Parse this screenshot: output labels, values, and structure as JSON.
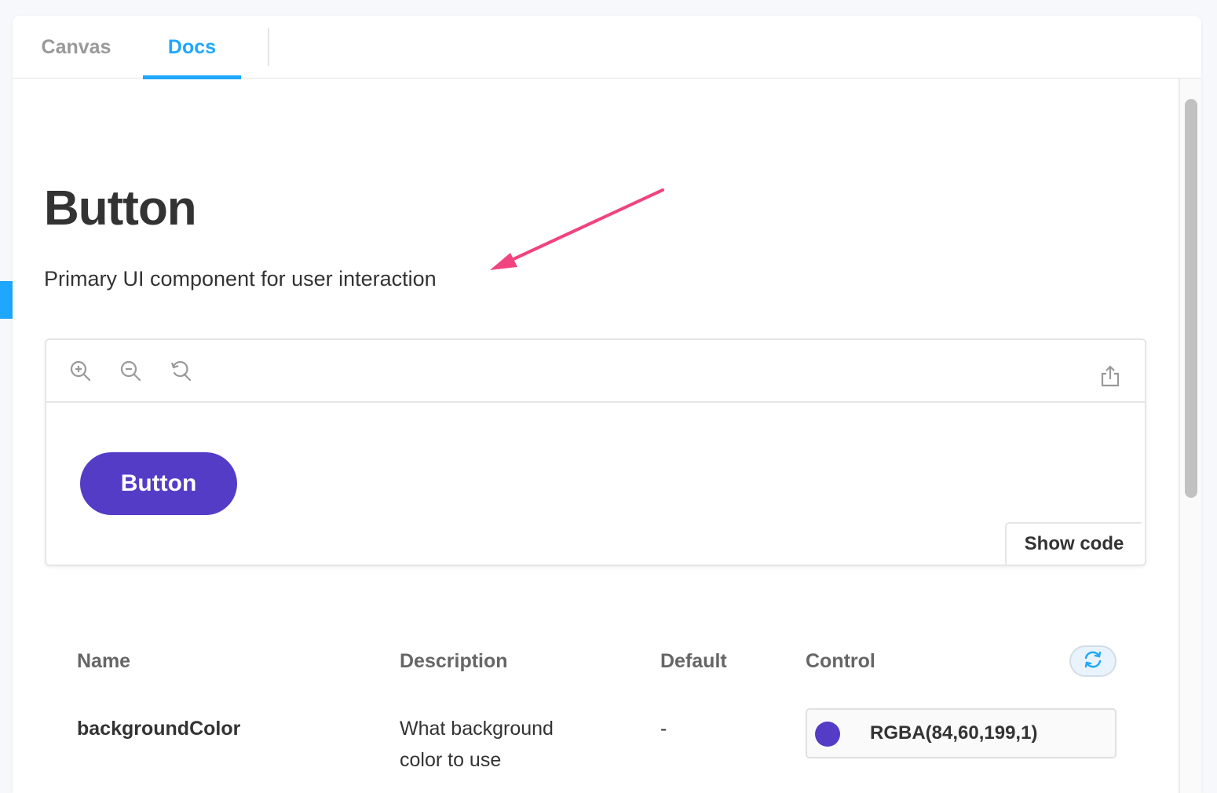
{
  "tabs": [
    {
      "label": "Canvas",
      "active": false
    },
    {
      "label": "Docs",
      "active": true
    }
  ],
  "colors": {
    "accent": "#1ea7fd",
    "button_bg": "#543cc7",
    "annotation_arrow": "#f0437f"
  },
  "docs": {
    "title": "Button",
    "subtitle": "Primary UI component for user interaction"
  },
  "preview": {
    "toolbar": {
      "zoom_in": "zoom-in-icon",
      "zoom_out": "zoom-out-icon",
      "reset_zoom": "reset-zoom-icon",
      "share": "share-icon"
    },
    "demo_button_label": "Button",
    "show_code_label": "Show code"
  },
  "args_table": {
    "headers": [
      "Name",
      "Description",
      "Default",
      "Control"
    ],
    "reset_icon": "sync-icon",
    "rows": [
      {
        "name": "backgroundColor",
        "description": "What background color to use",
        "default": "-",
        "control": {
          "type": "color",
          "value": "RGBA(84,60,199,1)",
          "swatch": "#543cc7"
        }
      }
    ]
  }
}
